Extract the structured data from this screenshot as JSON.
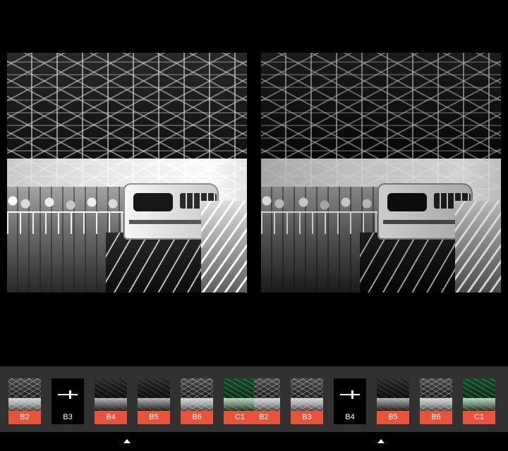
{
  "panels": [
    {
      "filters": [
        {
          "label": "B2",
          "style": "normal"
        },
        {
          "label": "B3",
          "style": "selected"
        },
        {
          "label": "B4",
          "style": "dark"
        },
        {
          "label": "B5",
          "style": "dark"
        },
        {
          "label": "B6",
          "style": "normal"
        },
        {
          "label": "C1",
          "style": "green"
        }
      ]
    },
    {
      "filters": [
        {
          "label": "B2",
          "style": "normal"
        },
        {
          "label": "B3",
          "style": "normal"
        },
        {
          "label": "B4",
          "style": "selected"
        },
        {
          "label": "B5",
          "style": "dark"
        },
        {
          "label": "B6",
          "style": "normal"
        },
        {
          "label": "C1",
          "style": "green"
        }
      ]
    }
  ],
  "colors": {
    "background": "#000000",
    "strip": "#313131",
    "label_accent": "#e8533b",
    "selected": "#000000"
  },
  "icons": {
    "selected_filter": "adjust-slider-icon",
    "position_marker": "triangle-up-icon"
  }
}
